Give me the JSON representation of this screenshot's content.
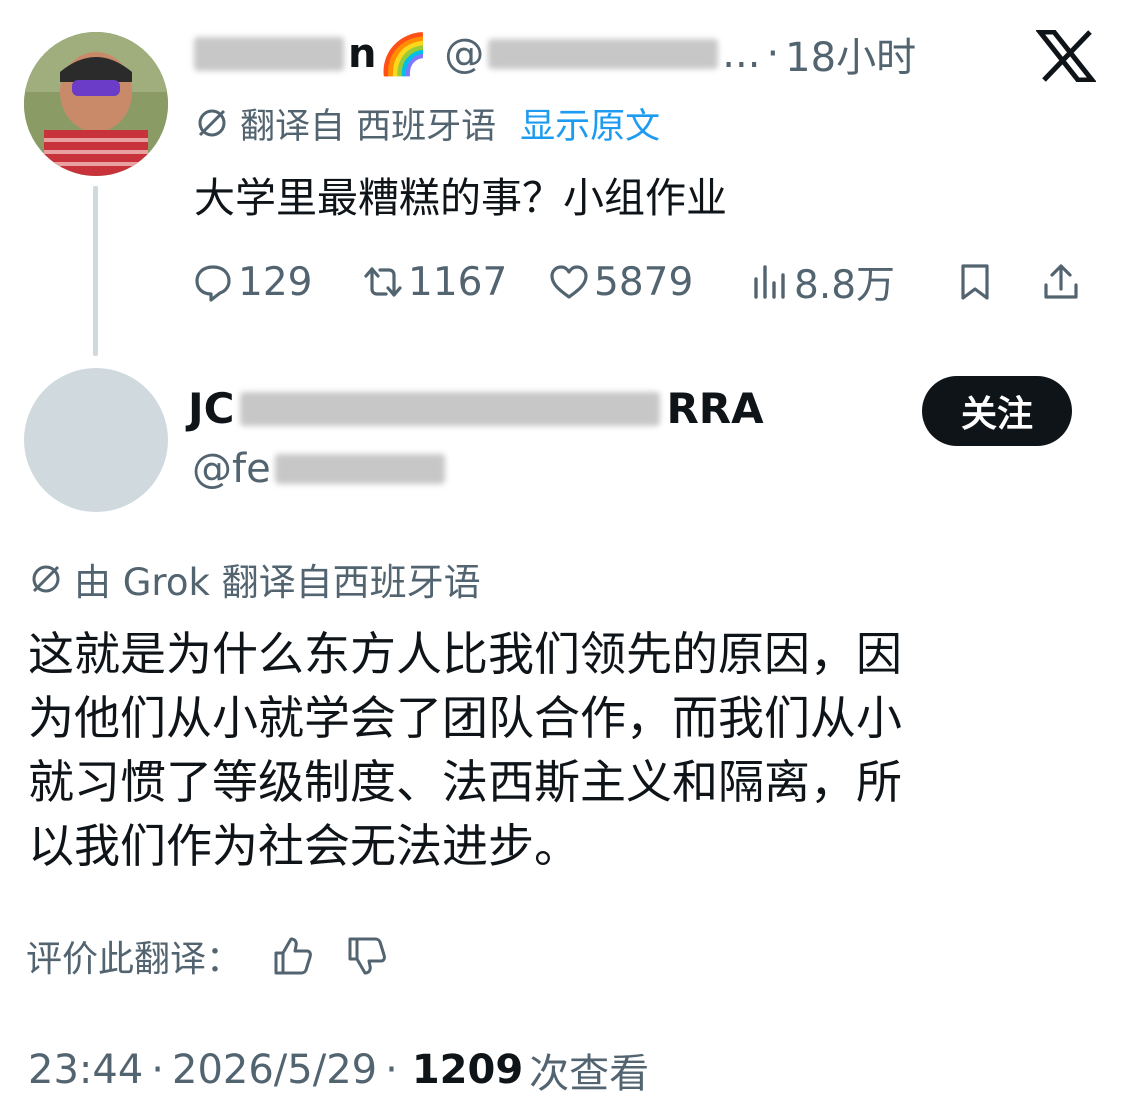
{
  "tweet1": {
    "name_suffix": "n",
    "emoji": "🌈",
    "handle_prefix": "@",
    "handle_suffix": "...",
    "separator": "·",
    "time": "18小时",
    "translated_from": "翻译自 西班牙语",
    "show_original": "显示原文",
    "text": "大学里最糟糕的事？小组作业",
    "stats": {
      "replies": "129",
      "reposts": "1167",
      "likes": "5879",
      "views": "8.8万"
    }
  },
  "tweet2": {
    "name_prefix": "JC",
    "name_suffix": "RRA",
    "handle_prefix": "@fe",
    "follow_label": "关注",
    "translated_by": "由 Grok 翻译自西班牙语",
    "text_lines": [
      "这就是为什么东方人比我们领先的原因，因",
      "为他们从小就学会了团队合作，而我们从小",
      "就习惯了等级制度、法西斯主义和隔离，所",
      "以我们作为社会无法进步。"
    ],
    "rate_label": "评价此翻译：",
    "meta": {
      "time": "23:44",
      "sep1": "·",
      "date": "2026/5/29",
      "sep2": "·",
      "views": "1209",
      "views_label": "次查看"
    }
  },
  "colors": {
    "link": "#1d9bf0",
    "secondary": "#536471",
    "primary": "#0f1419",
    "follow_bg": "#0f1419"
  },
  "icons": [
    "slash-circle-icon",
    "reply-icon",
    "repost-icon",
    "like-icon",
    "views-icon",
    "bookmark-icon",
    "share-icon",
    "thumbs-up-icon",
    "thumbs-down-icon",
    "x-logo-icon"
  ]
}
